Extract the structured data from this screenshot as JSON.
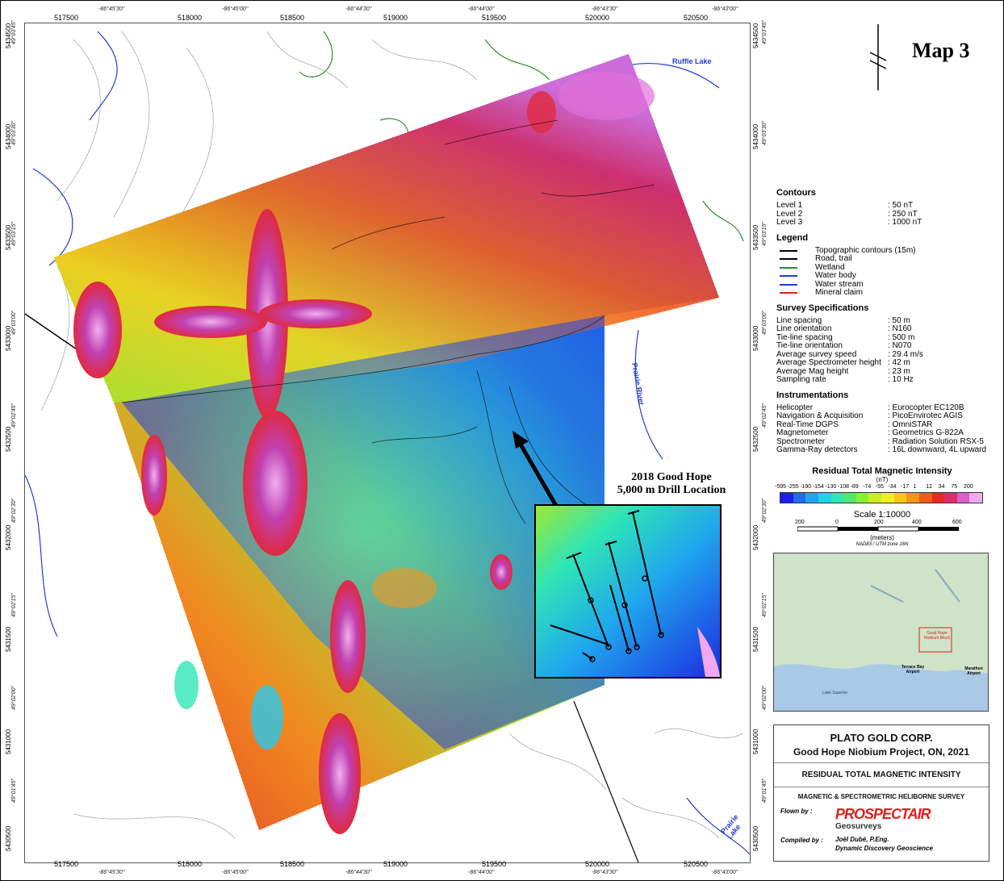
{
  "map_title": "Map 3",
  "place_labels": {
    "ruffle_lake": "Ruffle Lake",
    "prairie_river": "Prairie River",
    "prairie_lake": "Prairie Lake"
  },
  "easting_ticks": [
    "517500",
    "518000",
    "518500",
    "519000",
    "519500",
    "520000",
    "520500"
  ],
  "longitude_ticks": [
    "-86°45'30\"",
    "-86°45'00\"",
    "-86°44'30\"",
    "-86°44'00\"",
    "-86°43'30\"",
    "-86°43'00\""
  ],
  "northing_ticks": [
    "5434500",
    "5434000",
    "5433500",
    "5433000",
    "5432500",
    "5432000",
    "5431500",
    "5431000",
    "5430500"
  ],
  "latitude_ticks": [
    "49°03'45\"",
    "49°03'30\"",
    "49°03'15\"",
    "49°03'00\"",
    "49°02'45\"",
    "49°02'30\"",
    "49°02'15\"",
    "49°02'00\"",
    "49°01'45\""
  ],
  "callout": {
    "line1": "2018 Good Hope",
    "line2": "5,000 m Drill Location"
  },
  "contours": {
    "title": "Contours",
    "rows": [
      {
        "label": "Level 1",
        "value": ": 50 nT"
      },
      {
        "label": "Level 2",
        "value": ": 250 nT"
      },
      {
        "label": "Level 3",
        "value": ": 1000 nT"
      }
    ]
  },
  "legend": {
    "title": "Legend",
    "items": [
      {
        "label": "Topographic contours (15m)",
        "color": "#000000"
      },
      {
        "label": "Road, trail",
        "color": "#000000"
      },
      {
        "label": "Wetland",
        "color": "#2e8b2e"
      },
      {
        "label": "Water body",
        "color": "#1f3fd1"
      },
      {
        "label": "Water stream",
        "color": "#1f3fd1"
      },
      {
        "label": "Mineral claim",
        "color": "#e0201a"
      }
    ]
  },
  "survey": {
    "title": "Survey Specifications",
    "rows": [
      {
        "label": "Line spacing",
        "value": ": 50 m"
      },
      {
        "label": "Line orientation",
        "value": ": N160"
      },
      {
        "label": "Tie-line spacing",
        "value": ": 500 m"
      },
      {
        "label": "Tie-line orientation",
        "value": ": N070"
      },
      {
        "label": "Average survey speed",
        "value": ": 29.4 m/s"
      },
      {
        "label": "Average Spectrometer height",
        "value": ": 42 m"
      },
      {
        "label": "Average Mag height",
        "value": ": 23 m"
      },
      {
        "label": "Sampling rate",
        "value": ": 10 Hz"
      }
    ]
  },
  "instruments": {
    "title": "Instrumentations",
    "rows": [
      {
        "label": "Helicopter",
        "value": ": Eurocopter EC120B"
      },
      {
        "label": "Navigation & Acquisition",
        "value": ": PicoEnvirotec AGIS"
      },
      {
        "label": "Real-Time DGPS",
        "value": ": OmniSTAR"
      },
      {
        "label": "Magnetometer",
        "value": ": Geometrics G-822A"
      },
      {
        "label": "Spectrometer",
        "value": ": Radiation Solution RSX-5"
      },
      {
        "label": "Gamma-Ray detectors",
        "value": ": 16L downward, 4L upward"
      }
    ]
  },
  "colorbar": {
    "title": "Residual Total Magnetic Intensity",
    "unit": "(nT)",
    "labels": [
      "-595",
      "-255",
      "-190",
      "-154",
      "-130",
      "-108",
      "-89",
      "-74",
      "-55",
      "-34",
      "-17",
      "1",
      "12",
      "34",
      "75",
      "200"
    ],
    "colors": [
      "#1e1ef0",
      "#1f6cf0",
      "#1fa6ee",
      "#22d2e6",
      "#2fe6b4",
      "#4fe86a",
      "#8cf032",
      "#c8f020",
      "#eef020",
      "#f8c818",
      "#f8941a",
      "#f25a1c",
      "#e82a28",
      "#e02a70",
      "#d860c8",
      "#f2a8f0"
    ]
  },
  "scale": {
    "title": "Scale 1:10000",
    "labels": [
      "200",
      "0",
      "200",
      "400",
      "600"
    ],
    "unit": "(meters)",
    "datum": "NAD83 / UTM zone 16N"
  },
  "location_map": {
    "block_label": "Good Hope Niobium Block",
    "terrace_bay": "Terrace Bay Airport",
    "marathon": "Marathon Airport",
    "lake": "Lake Superior"
  },
  "titleblock": {
    "company": "PLATO GOLD CORP.",
    "project": "Good Hope Niobium Project, ON, 2021",
    "map_name": "RESIDUAL TOTAL MAGNETIC INTENSITY",
    "survey_name": "MAGNETIC & SPECTROMETRIC HELIBORNE SURVEY",
    "flown_by": "Flown by :",
    "logo_text": "PROSPECTAIR",
    "logo_sub": "Geosurveys",
    "compiled_by": "Compiled by :",
    "compiler_name": "Joël Dubé, P.Eng.",
    "compiler_company": "Dynamic Discovery Geoscience"
  }
}
